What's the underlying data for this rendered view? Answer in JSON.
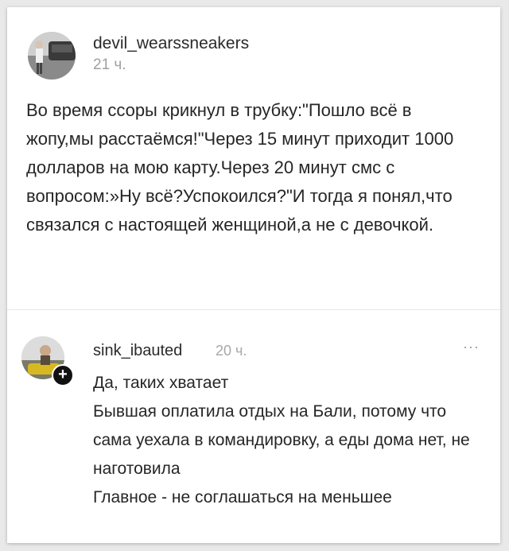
{
  "post": {
    "author": "devil_wearssneakers",
    "time": "21 ч.",
    "text": "Во время ссоры крикнул в трубку:\"Пошло всё в жопу,мы расстаёмся!\"Через 15 минут приходит 1000 долларов на мою карту.Через 20 минут смс с вопросом:»Ну всё?Успокоился?\"И тогда я понял,что связался с настоящей женщиной,а не с девочкой."
  },
  "comment": {
    "author": "sink_ibauted",
    "time": "20 ч.",
    "more_icon": "···",
    "text": "Да, таких хватает\nБывшая оплатила отдых на Бали, потому что сама уехала в командировку, а еды дома нет, не наготовила\nГлавное - не соглашаться на меньшее"
  }
}
